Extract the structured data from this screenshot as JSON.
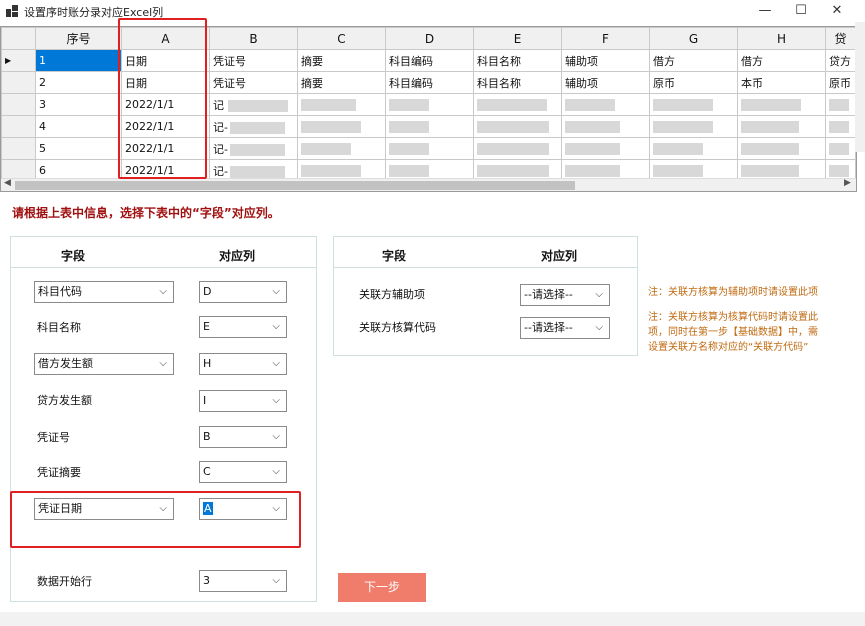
{
  "window": {
    "title": "设置序时账分录对应Excel列",
    "min_glyph": "—",
    "max_glyph": "☐",
    "close_glyph": "✕"
  },
  "grid": {
    "headers": [
      "序号",
      "A",
      "B",
      "C",
      "D",
      "E",
      "F",
      "G",
      "H",
      "贷"
    ],
    "rows": [
      {
        "num": "1",
        "a": "日期",
        "b": "凭证号",
        "c": "摘要",
        "d": "科目编码",
        "e": "科目名称",
        "f": "辅助项",
        "g": "借方",
        "h": "借方",
        "i": "贷方"
      },
      {
        "num": "2",
        "a": "日期",
        "b": "凭证号",
        "c": "摘要",
        "d": "科目编码",
        "e": "科目名称",
        "f": "辅助项",
        "g": "原币",
        "h": "本币",
        "i": "原币"
      },
      {
        "num": "3",
        "a": "2022/1/1",
        "b": "记",
        "c": "",
        "d": "",
        "e": "",
        "f": "",
        "g": "",
        "h": "",
        "i": ""
      },
      {
        "num": "4",
        "a": "2022/1/1",
        "b": "记-",
        "c": "",
        "d": "",
        "e": "",
        "f": "",
        "g": "",
        "h": "",
        "i": ""
      },
      {
        "num": "5",
        "a": "2022/1/1",
        "b": "记-",
        "c": "",
        "d": "",
        "e": "",
        "f": "",
        "g": "",
        "h": "",
        "i": ""
      },
      {
        "num": "6",
        "a": "2022/1/1",
        "b": "记-",
        "c": "",
        "d": "",
        "e": "",
        "f": "",
        "g": "",
        "h": "",
        "i": ""
      }
    ],
    "current_row_marker": "▶"
  },
  "hint": "请根据上表中信息，选择下表中的“字段”对应列。",
  "left_panel": {
    "col_field": "字段",
    "col_map": "对应列",
    "fields": [
      {
        "label": "科目代码",
        "is_dropdown": true,
        "value": "D"
      },
      {
        "label": "科目名称",
        "is_dropdown": false,
        "value": "E"
      },
      {
        "label": "借方发生额",
        "is_dropdown": true,
        "value": "H"
      },
      {
        "label": "贷方发生额",
        "is_dropdown": false,
        "value": "I"
      },
      {
        "label": "凭证号",
        "is_dropdown": false,
        "value": "B"
      },
      {
        "label": "凭证摘要",
        "is_dropdown": false,
        "value": "C"
      },
      {
        "label": "凭证日期",
        "is_dropdown": true,
        "value": "A"
      }
    ],
    "start_row_label": "数据开始行",
    "start_row_value": "3"
  },
  "right_panel": {
    "col_field": "字段",
    "col_map": "对应列",
    "fields": [
      {
        "label": "关联方辅助项",
        "value": "--请选择--"
      },
      {
        "label": "关联方核算代码",
        "value": "--请选择--"
      }
    ]
  },
  "notes": {
    "note1": "注：关联方核算为辅助项时请设置此项",
    "note2_line1": "注：关联方核算为核算代码时请设置此",
    "note2_line2": "项，同时在第一步【基础数据】中，需",
    "note2_line3": "设置关联方名称对应的“关联方代码”"
  },
  "next_button": "下一步",
  "colors": {
    "selection": "#0078d7",
    "highlight_box": "#e02020",
    "hint_text": "#a01010",
    "note_text": "#c06a10",
    "next_button": "#f07c6c"
  }
}
